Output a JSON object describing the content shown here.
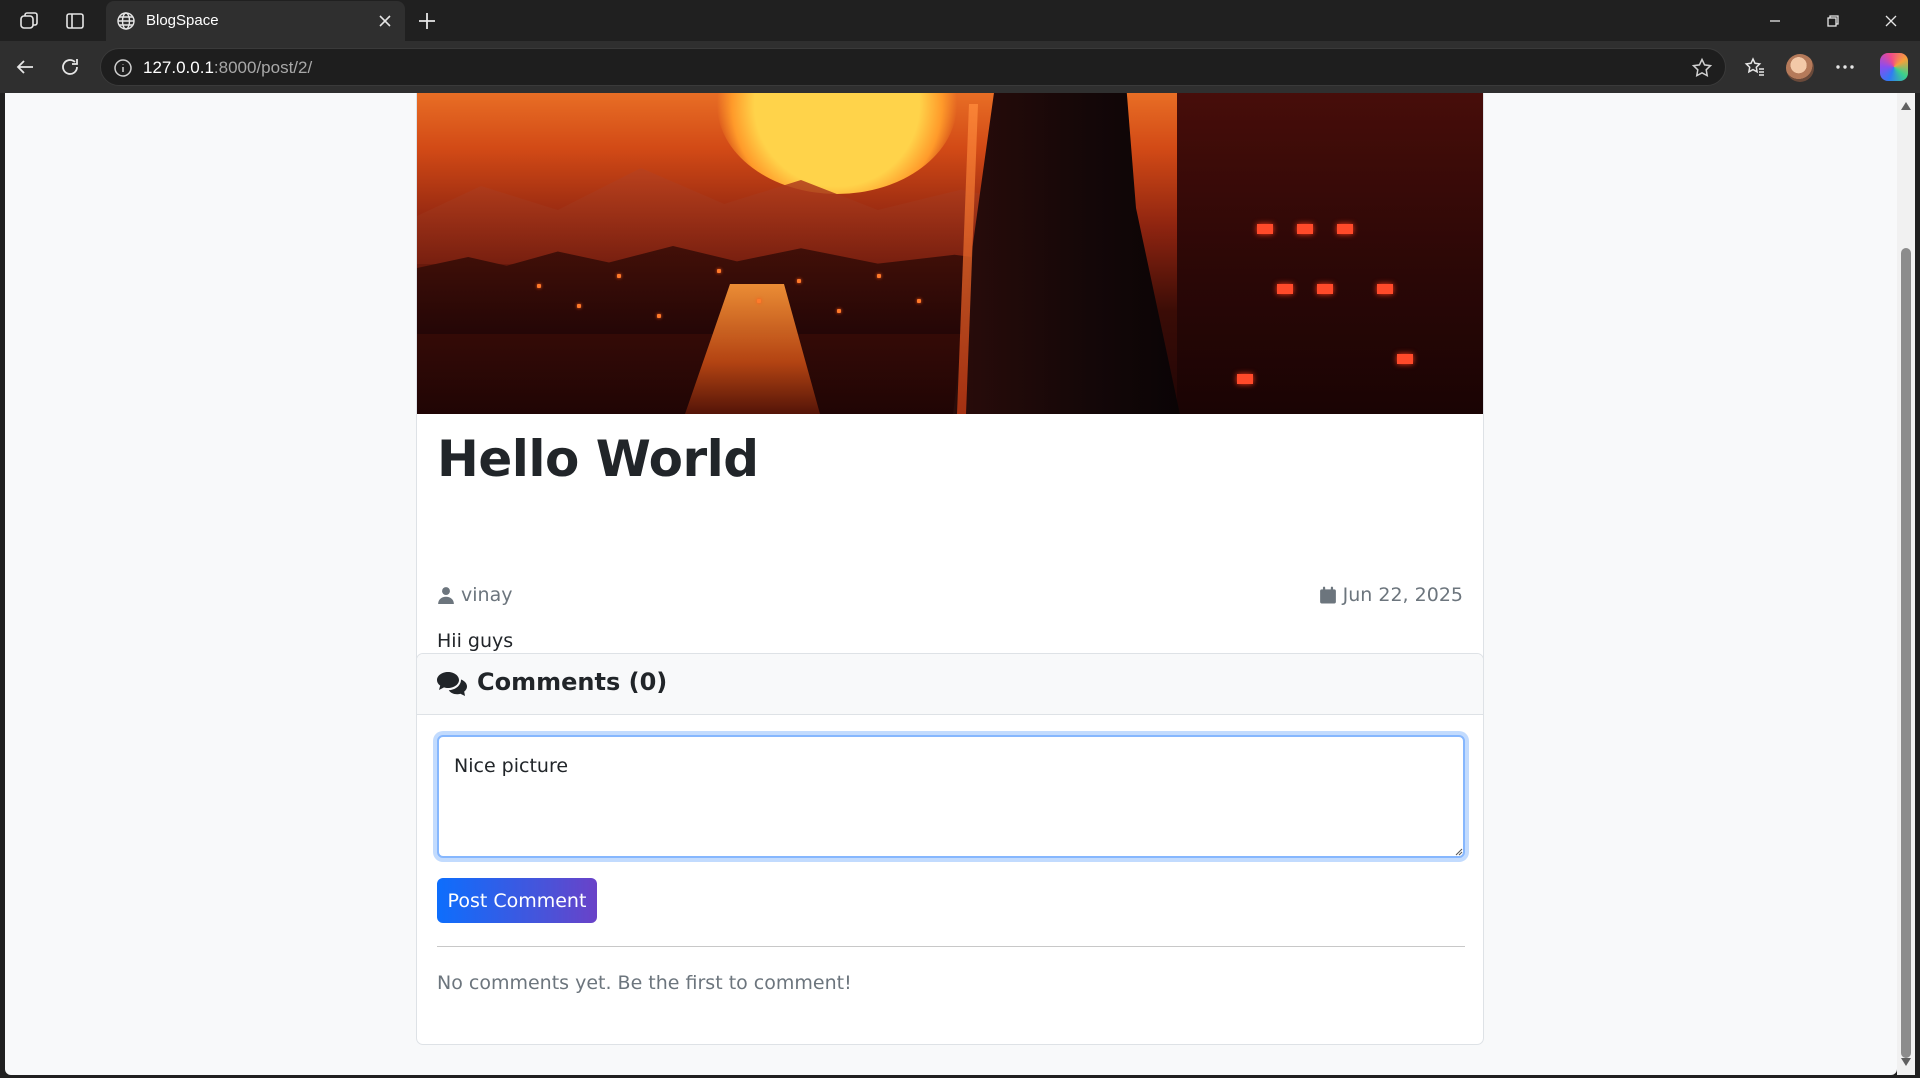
{
  "browser": {
    "tab_title": "BlogSpace",
    "url_host": "127.0.0.1",
    "url_rest": ":8000/post/2/"
  },
  "post": {
    "title": "Hello World",
    "author": "vinay",
    "date": "Jun 22, 2025",
    "body": "Hii guys"
  },
  "comments": {
    "title": "Comments (0)",
    "textarea_value": "Nice picture",
    "submit_label": "Post Comment",
    "empty_message": "No comments yet. Be the first to comment!"
  },
  "colors": {
    "primary": "#0d6efd",
    "muted": "#6c757d",
    "text": "#212529"
  }
}
